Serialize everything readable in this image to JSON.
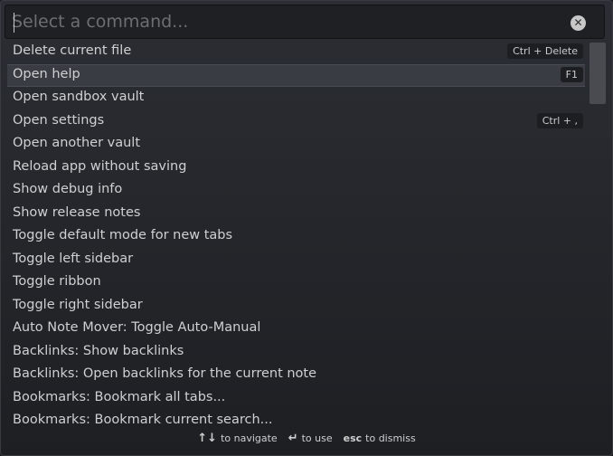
{
  "search": {
    "placeholder": "Select a command...",
    "value": "",
    "clear_icon": "close-icon"
  },
  "commands": [
    {
      "label": "Delete current file",
      "shortcut": "Ctrl + Delete",
      "selected": false
    },
    {
      "label": "Open help",
      "shortcut": "F1",
      "selected": true
    },
    {
      "label": "Open sandbox vault",
      "shortcut": "",
      "selected": false
    },
    {
      "label": "Open settings",
      "shortcut": "Ctrl + ,",
      "selected": false
    },
    {
      "label": "Open another vault",
      "shortcut": "",
      "selected": false
    },
    {
      "label": "Reload app without saving",
      "shortcut": "",
      "selected": false
    },
    {
      "label": "Show debug info",
      "shortcut": "",
      "selected": false
    },
    {
      "label": "Show release notes",
      "shortcut": "",
      "selected": false
    },
    {
      "label": "Toggle default mode for new tabs",
      "shortcut": "",
      "selected": false
    },
    {
      "label": "Toggle left sidebar",
      "shortcut": "",
      "selected": false
    },
    {
      "label": "Toggle ribbon",
      "shortcut": "",
      "selected": false
    },
    {
      "label": "Toggle right sidebar",
      "shortcut": "",
      "selected": false
    },
    {
      "label": "Auto Note Mover: Toggle Auto-Manual",
      "shortcut": "",
      "selected": false
    },
    {
      "label": "Backlinks: Show backlinks",
      "shortcut": "",
      "selected": false
    },
    {
      "label": "Backlinks: Open backlinks for the current note",
      "shortcut": "",
      "selected": false
    },
    {
      "label": "Bookmarks: Bookmark all tabs...",
      "shortcut": "",
      "selected": false
    },
    {
      "label": "Bookmarks: Bookmark current search...",
      "shortcut": "",
      "selected": false
    }
  ],
  "footer": {
    "navigate_keys": "↑↓",
    "navigate_label": "to navigate",
    "use_key": "↵",
    "use_label": "to use",
    "dismiss_key": "esc",
    "dismiss_label": "to dismiss"
  },
  "colors": {
    "background": "#25272c",
    "selected_row": "#3a3c43",
    "text": "#cfd0d2",
    "placeholder": "#6c6e74"
  }
}
